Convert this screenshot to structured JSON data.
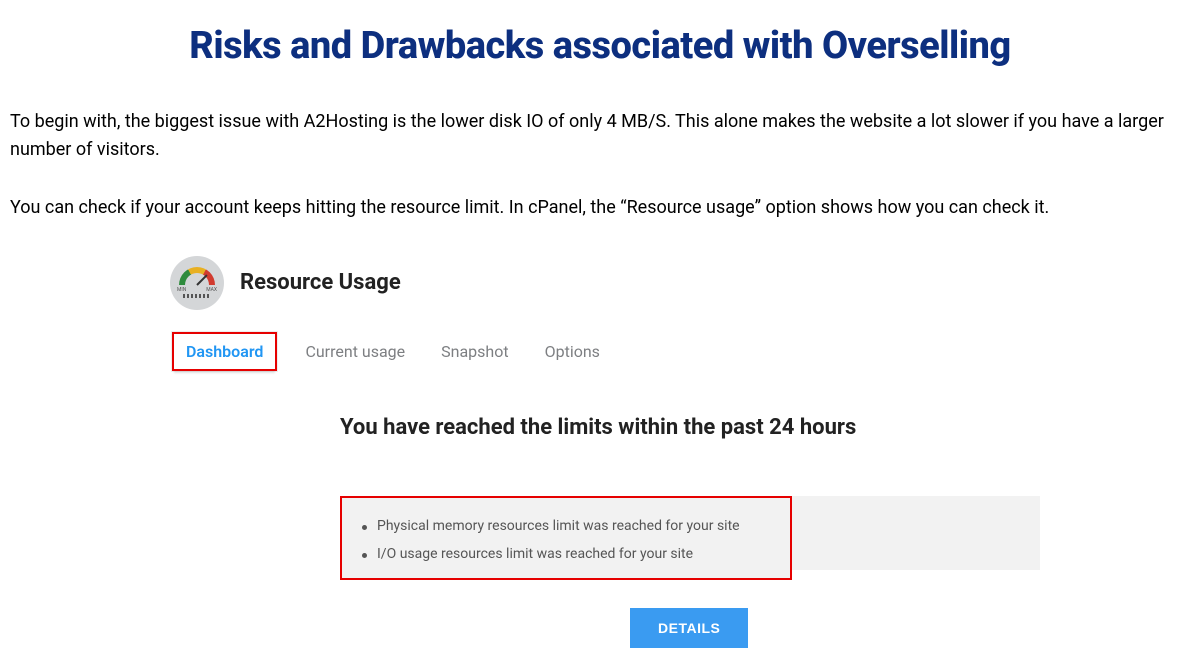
{
  "article": {
    "heading": "Risks and Drawbacks associated with Overselling",
    "paragraph1": "To begin with, the biggest issue with A2Hosting is the lower disk IO of only 4 MB/S. This alone makes the website a lot slower if you have a larger number of visitors.",
    "paragraph2": "You can check if your account keeps hitting the resource limit. In cPanel, the “Resource usage” option shows how you can check it."
  },
  "figure": {
    "icon_min": "MIN",
    "icon_max": "MAX",
    "title": "Resource Usage",
    "tabs": {
      "dashboard": "Dashboard",
      "current_usage": "Current usage",
      "snapshot": "Snapshot",
      "options": "Options"
    },
    "alert_heading": "You have reached the limits within the past 24 hours",
    "alerts": {
      "item1": "Physical memory resources limit was reached for your site",
      "item2": "I/O usage resources limit was reached for your site"
    },
    "details_button": "DETAILS"
  }
}
